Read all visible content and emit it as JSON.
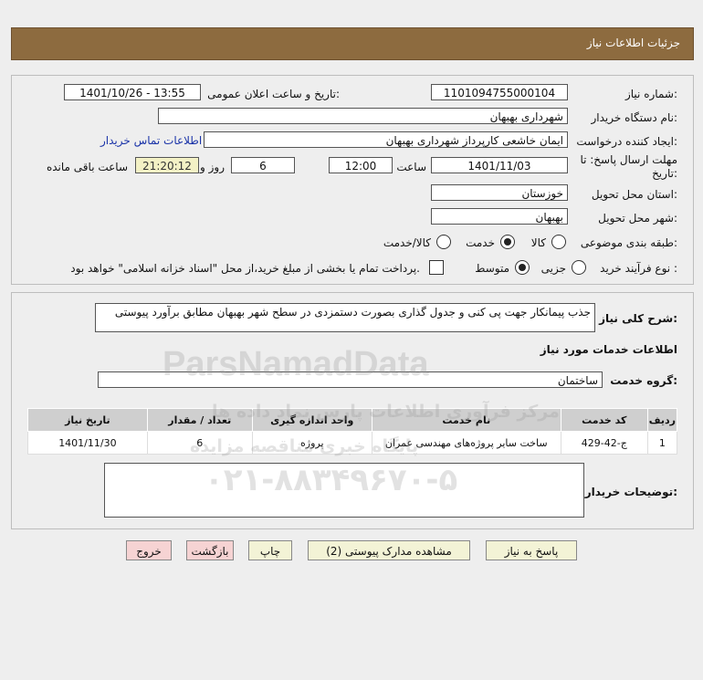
{
  "header": {
    "title": "جزئیات اطلاعات نیاز"
  },
  "form": {
    "need_number_label": "شماره نیاز:",
    "need_number": "1101094755000104",
    "announce_label": "تاریخ و ساعت اعلان عمومی:",
    "announce_value": "1401/10/26 - 13:55",
    "buyer_org_label": "نام دستگاه خریدار:",
    "buyer_org": "شهرداری بهبهان",
    "creator_label": "ایجاد کننده درخواست:",
    "creator": "ایمان خاشعی کارپرداز شهرداری بهبهان",
    "contact_link": "اطلاعات تماس خریدار",
    "deadline_label_1": "مهلت ارسال پاسخ: تا",
    "deadline_label_2": "تاریخ:",
    "deadline_date": "1401/11/03",
    "time_label": "ساعت",
    "deadline_time": "12:00",
    "days_value": "6",
    "days_label": "روز و",
    "remaining_time": "21:20:12",
    "remaining_label": "ساعت باقی مانده",
    "province_label": "استان محل تحویل:",
    "province": "خوزستان",
    "city_label": "شهر محل تحویل:",
    "city": "بهبهان",
    "category_label": "طبقه بندی موضوعی:",
    "category_options": [
      "کالا",
      "خدمت",
      "کالا/خدمت"
    ],
    "category_selected": "خدمت",
    "process_label": "نوع فرآیند خرید :",
    "process_options": [
      "جزیی",
      "متوسط"
    ],
    "process_selected": "متوسط",
    "treasury_note": "پرداخت تمام یا بخشی از مبلغ خرید،از محل \"اسناد خزانه اسلامی\" خواهد بود."
  },
  "details": {
    "summary_label": "شرح کلی نیاز:",
    "summary": "جذب پیمانکار جهت پی کنی و جدول گذاری بصورت دستمزدی در سطح شهر بهبهان مطابق برآورد پیوستی",
    "services_title": "اطلاعات خدمات مورد نیاز",
    "service_group_label": "گروه خدمت:",
    "service_group": "ساختمان",
    "table": {
      "headers": [
        "ردیف",
        "کد خدمت",
        "نام خدمت",
        "واحد اندازه گیری",
        "تعداد / مقدار",
        "تاریخ نیاز"
      ],
      "rows": [
        [
          "1",
          "ج-42-429",
          "ساخت سایر پروژه‌های مهندسی عمران",
          "پروژه",
          "6",
          "1401/11/30"
        ]
      ]
    },
    "buyer_notes_label": "توضیحات خریدار:",
    "buyer_notes": ""
  },
  "buttons": {
    "reply": "پاسخ به نیاز",
    "attachments": "مشاهده مدارک پیوستی (2)",
    "print": "چاپ",
    "back": "بازگشت",
    "exit": "خروج"
  },
  "watermark": {
    "brand": "ParsNamadData",
    "line1": "مرکز فرآوری اطلاعات پارس نماد داده ها",
    "line2": "پایگاه خبری مناقصه مزایده",
    "phone": "۰۲۱-۸۸۳۴۹۶۷۰-۵"
  }
}
